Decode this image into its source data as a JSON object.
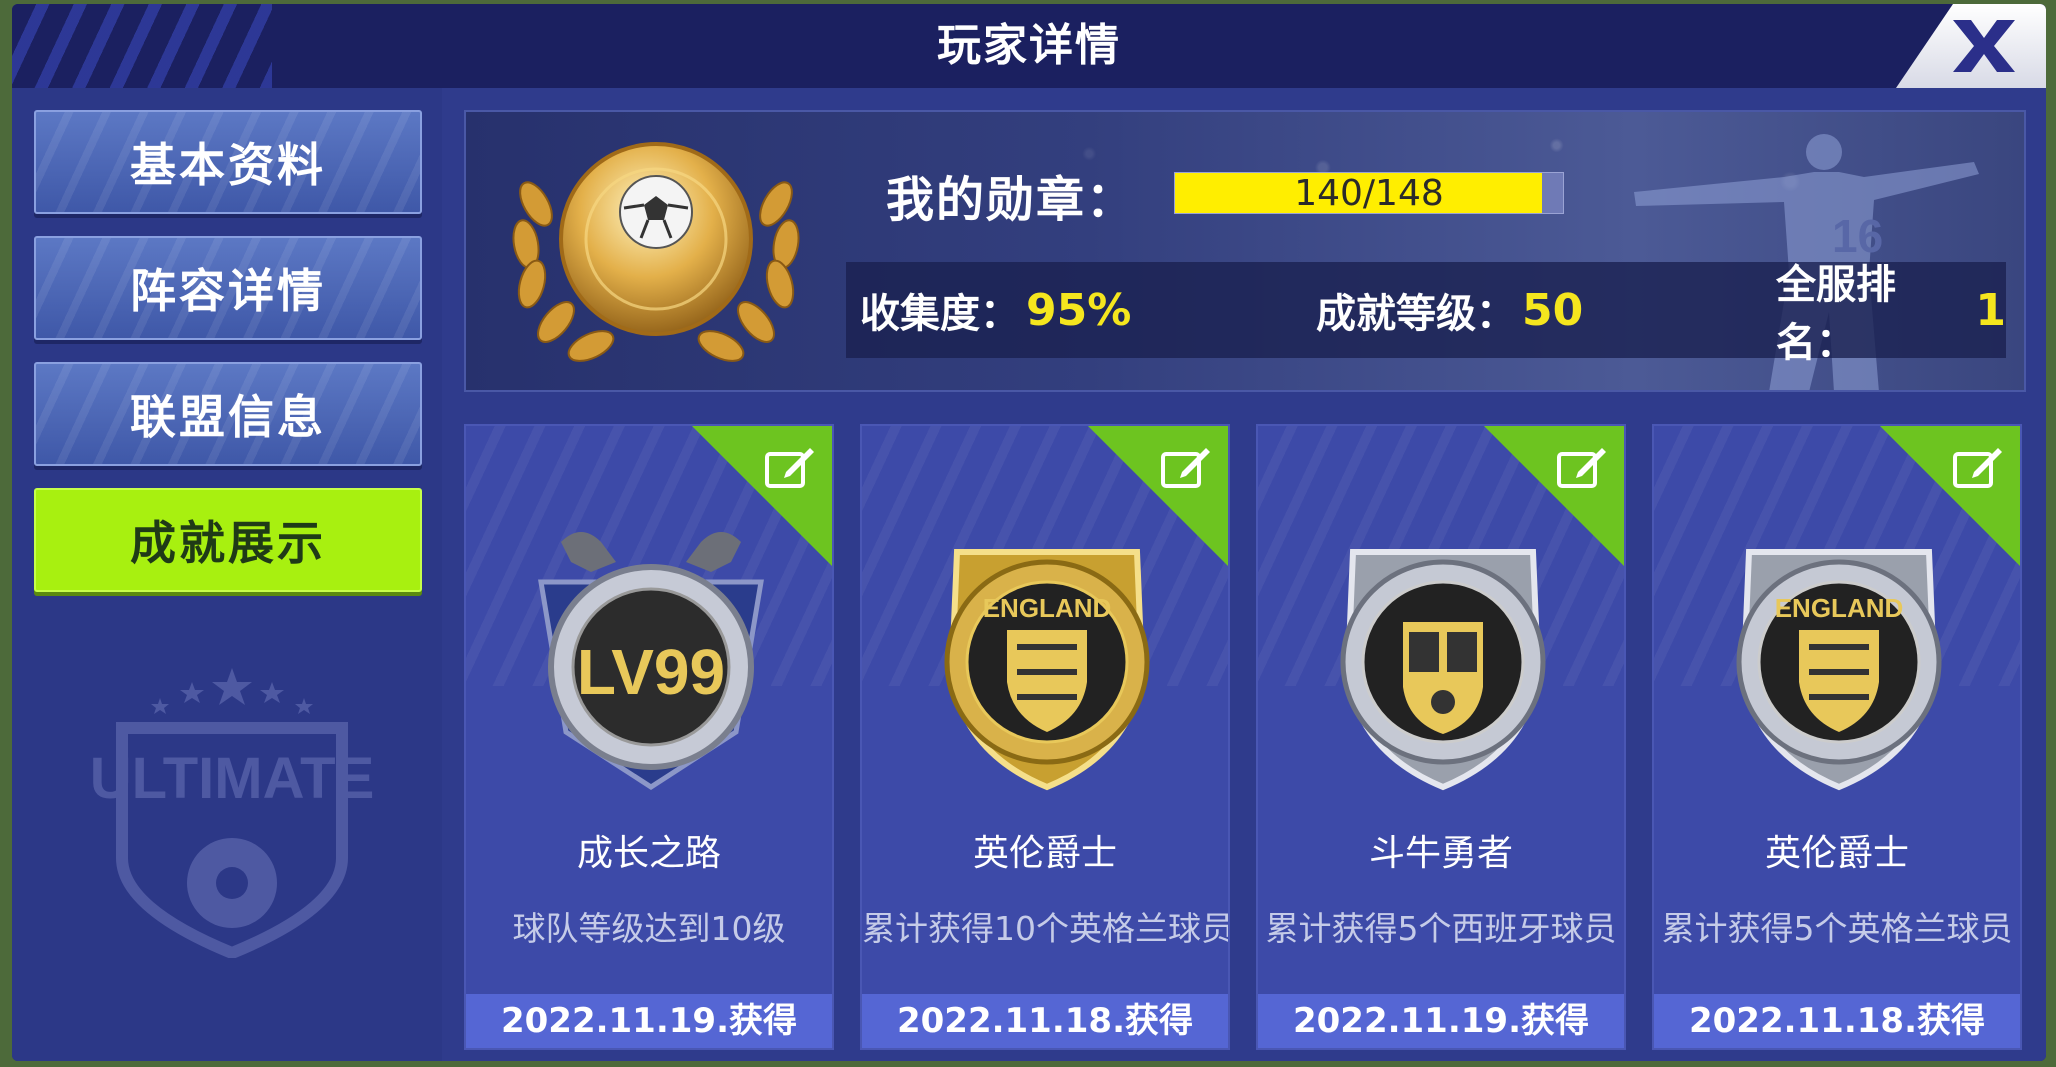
{
  "title": "玩家详情",
  "sidebar": {
    "items": [
      {
        "label": "基本资料",
        "active": false
      },
      {
        "label": "阵容详情",
        "active": false
      },
      {
        "label": "联盟信息",
        "active": false
      },
      {
        "label": "成就展示",
        "active": true
      }
    ],
    "logo_text": "ULTIMATE"
  },
  "hero": {
    "badge_label": "我的勋章：",
    "badge_progress_text": "140/148",
    "badge_current": 140,
    "badge_total": 148,
    "collection_label": "收集度：",
    "collection_value": "95%",
    "level_label": "成就等级：",
    "level_value": "50",
    "rank_label": "全服排名：",
    "rank_value": "1"
  },
  "achievements": [
    {
      "name": "成长之路",
      "desc": "球队等级达到10级",
      "date": "2022.11.19.获得",
      "badge_text": "LV99",
      "badge_type": "level-badge-icon"
    },
    {
      "name": "英伦爵士",
      "desc": "累计获得10个英格兰球员",
      "date": "2022.11.18.获得",
      "badge_text": "ENGLAND",
      "badge_type": "england-gold-badge-icon"
    },
    {
      "name": "斗牛勇者",
      "desc": "累计获得5个西班牙球员",
      "date": "2022.11.19.获得",
      "badge_text": "",
      "badge_type": "spain-silver-badge-icon"
    },
    {
      "name": "英伦爵士",
      "desc": "累计获得5个英格兰球员",
      "date": "2022.11.18.获得",
      "badge_text": "ENGLAND",
      "badge_type": "england-silver-badge-icon"
    }
  ],
  "colors": {
    "accent_green": "#a8f010",
    "progress_yellow": "#ffee00",
    "stat_value_yellow": "#f5e61e",
    "panel_blue": "#2f3b8c"
  }
}
